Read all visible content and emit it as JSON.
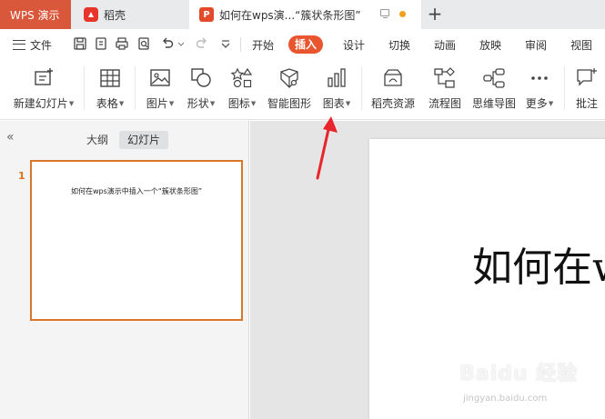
{
  "tabs": [
    {
      "label": "WPS 演示"
    },
    {
      "label": "稻壳"
    },
    {
      "label": "如何在wps演...“簇状条形图”"
    }
  ],
  "menu": {
    "file": "文件",
    "items": [
      {
        "label": "开始"
      },
      {
        "label": "插入"
      },
      {
        "label": "设计"
      },
      {
        "label": "切换"
      },
      {
        "label": "动画"
      },
      {
        "label": "放映"
      },
      {
        "label": "审阅"
      },
      {
        "label": "视图"
      }
    ],
    "active": "插入"
  },
  "ribbon": {
    "items": [
      {
        "label": "新建幻灯片",
        "icon": "new-slide-icon",
        "dropdown": true
      },
      {
        "label": "表格",
        "icon": "table-icon",
        "dropdown": true
      },
      {
        "label": "图片",
        "icon": "picture-icon",
        "dropdown": true
      },
      {
        "label": "形状",
        "icon": "shape-icon",
        "dropdown": true
      },
      {
        "label": "图标",
        "icon": "icon-library-icon",
        "dropdown": true
      },
      {
        "label": "智能图形",
        "icon": "smart-art-icon",
        "dropdown": false
      },
      {
        "label": "图表",
        "icon": "chart-icon",
        "dropdown": true
      },
      {
        "label": "稻壳资源",
        "icon": "daoke-resource-icon",
        "dropdown": false
      },
      {
        "label": "流程图",
        "icon": "flowchart-icon",
        "dropdown": false
      },
      {
        "label": "思维导图",
        "icon": "mindmap-icon",
        "dropdown": false
      },
      {
        "label": "更多",
        "icon": "more-icon",
        "dropdown": true
      },
      {
        "label": "批注",
        "icon": "comment-icon",
        "dropdown": false
      }
    ]
  },
  "panel": {
    "outline_tab": "大纲",
    "slides_tab": "幻灯片",
    "slide_number": "1",
    "slide_thumb_title": "如何在wps演示中插入一个“簇状条形图”"
  },
  "canvas": {
    "slide_title": "如何在w"
  },
  "watermark": {
    "main": "Baidu 经验",
    "sub": "jingyan.baidu.com"
  },
  "colors": {
    "accent": "#e8552e",
    "wps_tab": "#d9573a",
    "slide_border": "#d8772a",
    "annotation_arrow": "#e8252a"
  }
}
